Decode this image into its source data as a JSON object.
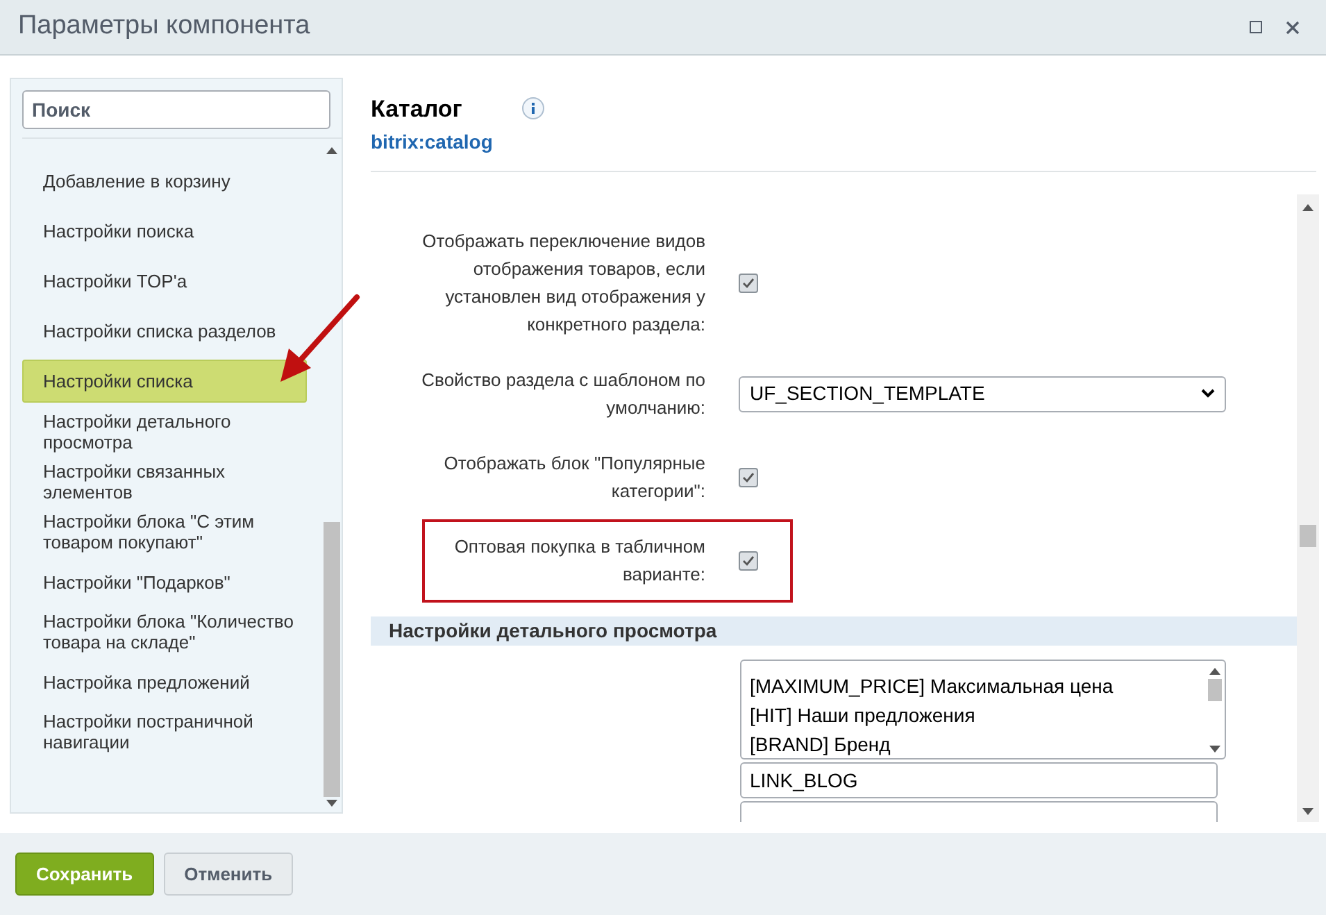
{
  "window": {
    "title": "Параметры компонента"
  },
  "sidebar": {
    "search": {
      "placeholder": "Поиск"
    },
    "items": [
      {
        "label": "Добавление в корзину",
        "selected": false
      },
      {
        "label": "Настройки поиска",
        "selected": false
      },
      {
        "label": "Настройки TOP'а",
        "selected": false
      },
      {
        "label": "Настройки списка разделов",
        "selected": false
      },
      {
        "label": "Настройки списка",
        "selected": true
      },
      {
        "label": "Настройки детального просмотра",
        "selected": false
      },
      {
        "label": "Настройки связанных элементов",
        "selected": false
      },
      {
        "label": "Настройки блока \"С этим товаром покупают\"",
        "selected": false
      },
      {
        "label": "Настройки \"Подарков\"",
        "selected": false
      },
      {
        "label": "Настройки блока \"Количество товара на складе\"",
        "selected": false
      },
      {
        "label": "Настройка предложений",
        "selected": false
      },
      {
        "label": "Настройки постраничной навигации",
        "selected": false
      }
    ]
  },
  "component": {
    "title": "Каталог",
    "code": "bitrix:catalog"
  },
  "settings": [
    {
      "kind": "checkbox",
      "label": "Отображать переключение видов отображения товаров, если установлен вид отображения у конкретного раздела:",
      "checked": true,
      "highlighted": false
    },
    {
      "kind": "select",
      "label": "Свойство раздела с шаблоном по умолчанию:",
      "value": "UF_SECTION_TEMPLATE",
      "highlighted": false
    },
    {
      "kind": "checkbox",
      "label": "Отображать блок \"Популярные категории\":",
      "checked": true,
      "highlighted": false
    },
    {
      "kind": "checkbox",
      "label": "Оптовая покупка в табличном варианте:",
      "checked": true,
      "highlighted": true
    }
  ],
  "section": {
    "title": "Настройки детального просмотра",
    "multiselect": [
      "[MAXIMUM_PRICE] Максимальная цена",
      "[HIT] Наши предложения",
      "[BRAND] Бренд"
    ],
    "fields": [
      {
        "value": "LINK_BLOG"
      }
    ]
  },
  "buttons": [
    {
      "label": "Сохранить",
      "kind": "primary"
    },
    {
      "label": "Отменить",
      "kind": "secondary"
    }
  ]
}
